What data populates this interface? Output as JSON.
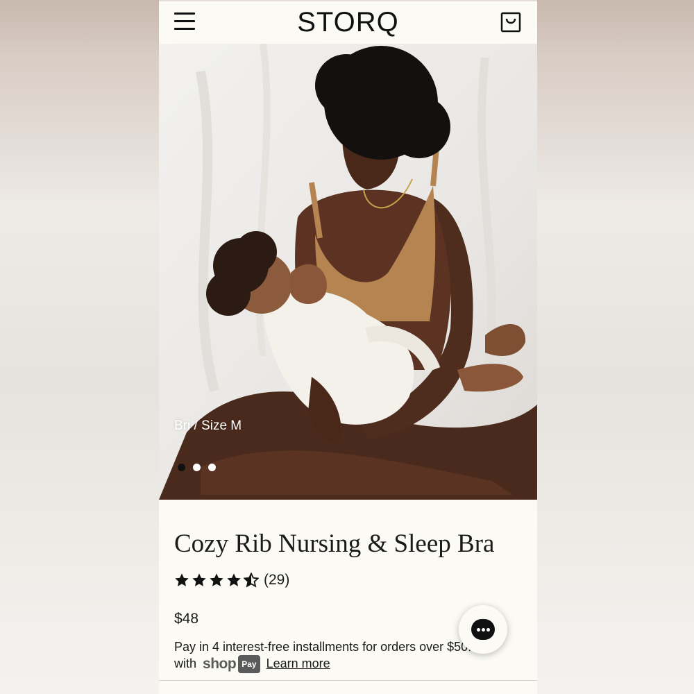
{
  "header": {
    "brand": "STORQ",
    "menu_icon": "hamburger-menu-icon",
    "cart_icon": "shopping-bag-icon"
  },
  "hero": {
    "caption": "Bri / Size M",
    "carousel": {
      "slides": 3,
      "active": 1
    }
  },
  "product": {
    "title": "Cozy Rib Nursing & Sleep Bra",
    "rating": 4.5,
    "review_count": "(29)",
    "price": "$48",
    "installments_text": "Pay in 4 interest-free installments for orders over $50.00",
    "installments_with": "with",
    "shop_word": "shop",
    "pay_pill": "Pay",
    "learn_more": "Learn more"
  },
  "chat": {
    "icon": "chat-bubble-icon"
  },
  "colors": {
    "background": "#fbfaf5",
    "text": "#1a1a1a",
    "shop_pay_gray": "#5a5a5a"
  }
}
